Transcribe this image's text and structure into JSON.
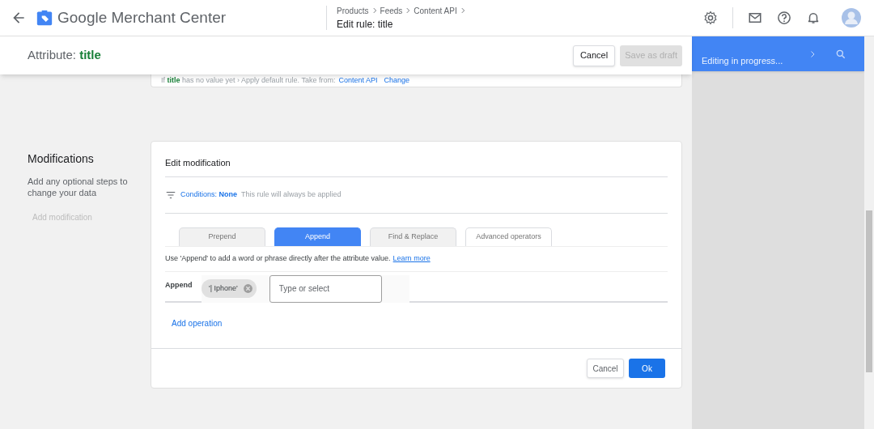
{
  "topbar": {
    "title": "Google Merchant Center",
    "breadcrumbs": [
      "Products",
      "Feeds",
      "Content API"
    ],
    "page_title": "Edit rule: title"
  },
  "header": {
    "label": "Attribute:",
    "attribute": "title",
    "buttons": [
      {
        "label": "Cancel",
        "disabled": false
      },
      {
        "label": "Save as draft",
        "disabled": true
      }
    ]
  },
  "side_panel": {
    "status": "Editing in progress..."
  },
  "default_rule": {
    "text": "If **title** has no value yet › Apply default rule. Take from:",
    "source": "Content API",
    "change": "Change"
  },
  "section": {
    "title": "Modifications",
    "description": "Add any optional steps to change your data",
    "add_button": "Add modification"
  },
  "modification": {
    "title": "Edit modification",
    "conditions": {
      "label": "Conditions:",
      "value": "None",
      "note": "This rule will always be applied"
    },
    "tabs": [
      {
        "label": "Prepend",
        "kind": "basic",
        "selected": false
      },
      {
        "label": "Append",
        "kind": "basic",
        "selected": true
      },
      {
        "label": "Find & Replace",
        "kind": "basic",
        "selected": false
      },
      {
        "label": "Advanced operators",
        "kind": "advanced",
        "selected": false
      }
    ],
    "help": "Use 'Append' to add a word or phrase directly after the attribute value.",
    "help_link": "Learn more",
    "operation": {
      "label": "Append",
      "chips": [
        "'| Iphone'"
      ],
      "placeholder": "Type or select"
    },
    "add_operation": "Add operation",
    "buttons": [
      {
        "label": "Cancel",
        "kind": "secondary"
      },
      {
        "label": "Ok",
        "kind": "primary"
      }
    ]
  }
}
